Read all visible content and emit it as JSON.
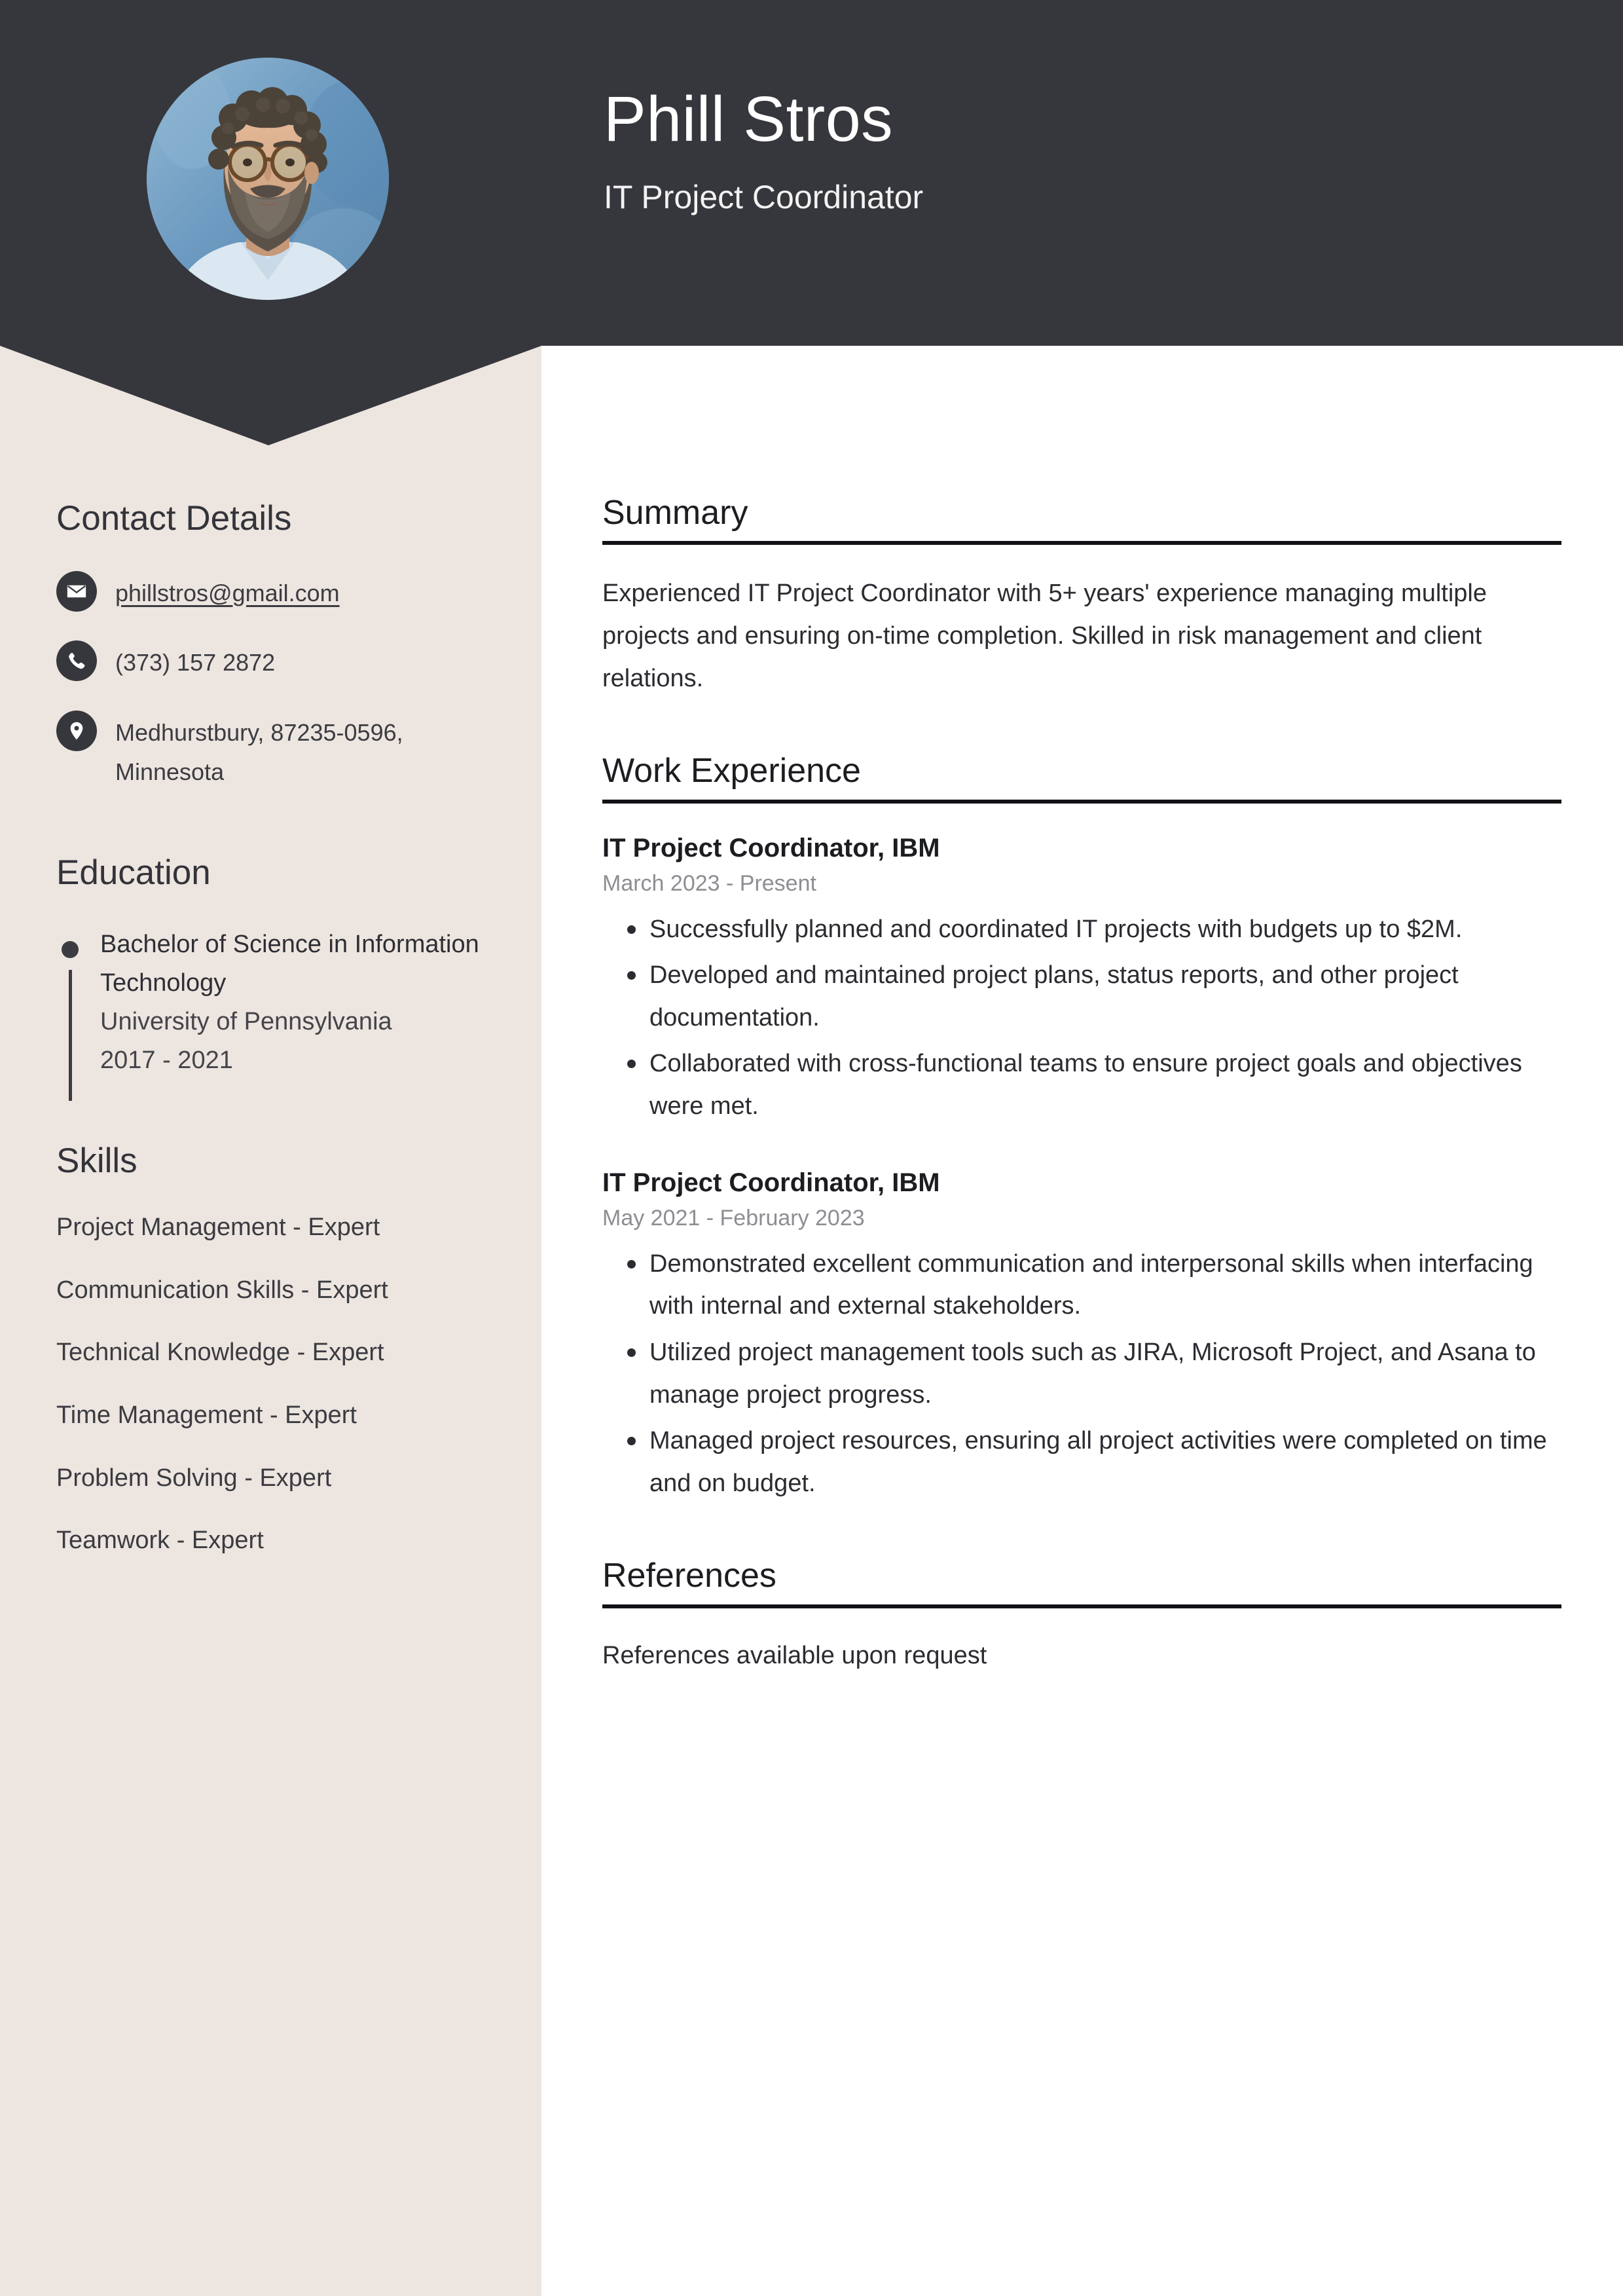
{
  "header": {
    "name": "Phill Stros",
    "job_title": "IT Project Coordinator",
    "avatar_alt": "portrait-photo",
    "background_color": "#36373c"
  },
  "sidebar": {
    "background_color": "#ede5e0",
    "contact": {
      "heading": "Contact Details",
      "items": [
        {
          "icon": "envelope-icon",
          "value": "phillstros@gmail.com",
          "is_link": true
        },
        {
          "icon": "phone-icon",
          "value": "(373) 157 2872",
          "is_link": false
        },
        {
          "icon": "location-pin-icon",
          "value": "Medhurstbury, 87235-0596, Minnesota",
          "is_link": false
        }
      ]
    },
    "education": {
      "heading": "Education",
      "items": [
        {
          "degree": "Bachelor of Science in Information Technology",
          "school": "University of Pennsylvania",
          "years": "2017 - 2021"
        }
      ]
    },
    "skills": {
      "heading": "Skills",
      "items": [
        "Project Management - Expert",
        "Communication Skills - Expert",
        "Technical Knowledge - Expert",
        "Time Management - Expert",
        "Problem Solving - Expert",
        "Teamwork - Expert"
      ]
    }
  },
  "main": {
    "summary": {
      "heading": "Summary",
      "text": "Experienced IT Project Coordinator with 5+ years' experience managing multiple projects and ensuring on-time completion. Skilled in risk management and client relations."
    },
    "work_experience": {
      "heading": "Work Experience",
      "jobs": [
        {
          "role": "IT Project Coordinator, IBM",
          "dates": "March 2023 - Present",
          "bullets": [
            "Successfully planned and coordinated IT projects with budgets up to $2M.",
            "Developed and maintained project plans, status reports, and other project documentation.",
            "Collaborated with cross-functional teams to ensure project goals and objectives were met."
          ]
        },
        {
          "role": "IT Project Coordinator, IBM",
          "dates": "May 2021 - February 2023",
          "bullets": [
            "Demonstrated excellent communication and interpersonal skills when interfacing with internal and external stakeholders.",
            "Utilized project management tools such as JIRA, Microsoft Project, and Asana to manage project progress.",
            "Managed project resources, ensuring all project activities were completed on time and on budget."
          ]
        }
      ]
    },
    "references": {
      "heading": "References",
      "text": "References available upon request"
    }
  }
}
